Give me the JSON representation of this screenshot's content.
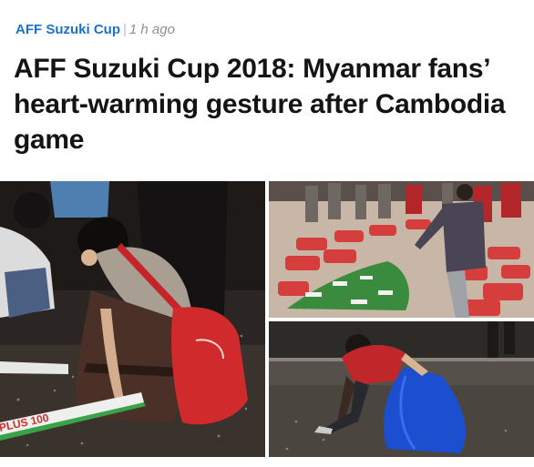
{
  "article": {
    "category": "AFF Suzuki Cup",
    "separator": "|",
    "time_ago": "1 h ago",
    "headline": "AFF Suzuki Cup 2018: Myanmar fans’ heart-warming gesture after Cambodia game"
  },
  "photos": {
    "main": {
      "banner_text": "PLUS 100"
    }
  },
  "colors": {
    "category": "#1a73c9",
    "headline": "#141414",
    "meta": "#8a8f96"
  }
}
